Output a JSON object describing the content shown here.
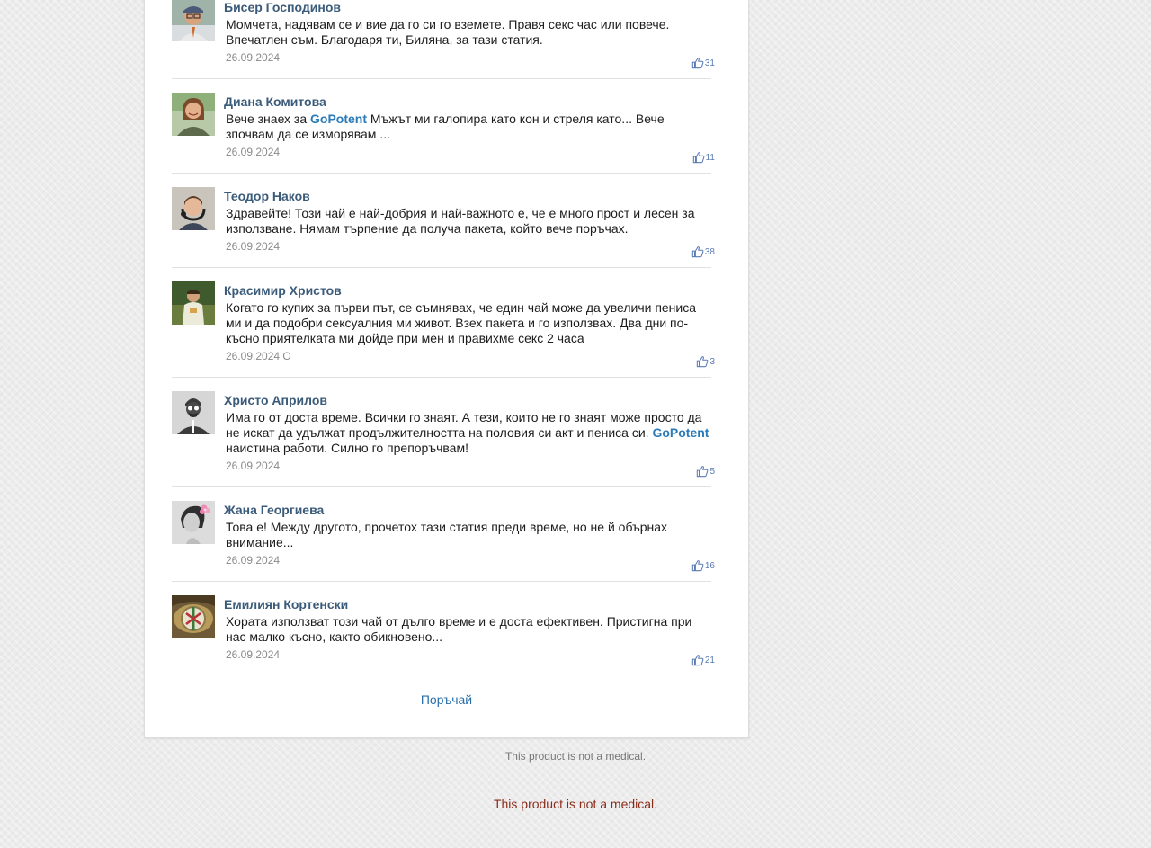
{
  "comments": [
    {
      "author": "Бисер Господинов",
      "text_before": "Момчета, надявам се и вие да го си го вземете. Правя секс час или повече. Впечатлен съм. Благодаря ти, Биляна, за тази статия.",
      "brand": "",
      "text_after": "",
      "date": "26.09.2024",
      "likes": "31",
      "avatar": "man-cap-glasses-avatar"
    },
    {
      "author": "Диана Комитова",
      "text_before": "Вече знаех за ",
      "brand": "GoPotent",
      "text_after": " Мъжът ми галопира като кон и стреля като... Вече зпочвам да се изморявам ...",
      "date": "26.09.2024",
      "likes": "11",
      "avatar": "woman-smiling-avatar"
    },
    {
      "author": "Теодор Наков",
      "text_before": "Здравейте! Този чай е най-добрия и най-важното е, че е много прост и лесен за използване. Нямам търпение да получа пакета, който вече поръчах.",
      "brand": "",
      "text_after": "",
      "date": "26.09.2024",
      "likes": "38",
      "avatar": "young-man-headphones-avatar"
    },
    {
      "author": "Красимир Христов",
      "text_before": "Когато го купих за първи път, се съмнявах, че един чай може да увеличи пениса ми и да подобри сексуалния ми живот. Взех пакета и го използвах. Два дни по-късно приятелката ми дойде при мен и правихме секс 2 часа",
      "brand": "",
      "text_after": "",
      "date": "26.09.2024 О",
      "likes": "3",
      "avatar": "man-outdoors-avatar"
    },
    {
      "author": "Христо Априлов",
      "text_before": "Има го от доста време. Всички го знаят. А тези, които не го знаят може просто да не искат да удължат продължителността на половия си акт и пениса си. ",
      "brand": "GoPotent",
      "text_after": " наистина работи. Силно го препоръчвам!",
      "date": "26.09.2024",
      "likes": "5",
      "avatar": "hipster-silhouette-avatar"
    },
    {
      "author": "Жана Георгиева",
      "text_before": "Това е! Между другото, прочетох тази статия преди време, но не й обърнах внимание...",
      "brand": "",
      "text_after": "",
      "date": "26.09.2024",
      "likes": "16",
      "avatar": "woman-flower-bw-avatar"
    },
    {
      "author": "Емилиян Кортенски",
      "text_before": "Хората използват този чай от дълго време и е доста ефективен. Пристигна при нас малко късно, както обикновено...",
      "brand": "",
      "text_after": "",
      "date": "26.09.2024",
      "likes": "21",
      "avatar": "car-emblem-avatar"
    }
  ],
  "order_link": "Поръчай",
  "footer": {
    "small_disclaimer": "This product is not a medical.",
    "big_disclaimer": "This product is not a medical."
  },
  "colors": {
    "author": "#3b5b7a",
    "brand": "#2a7bb8",
    "link": "#2a6fa8",
    "disclaimer": "#8b2c1a",
    "likes": "#5a7bb5"
  },
  "icons": {
    "like": "thumbs-up-icon"
  }
}
